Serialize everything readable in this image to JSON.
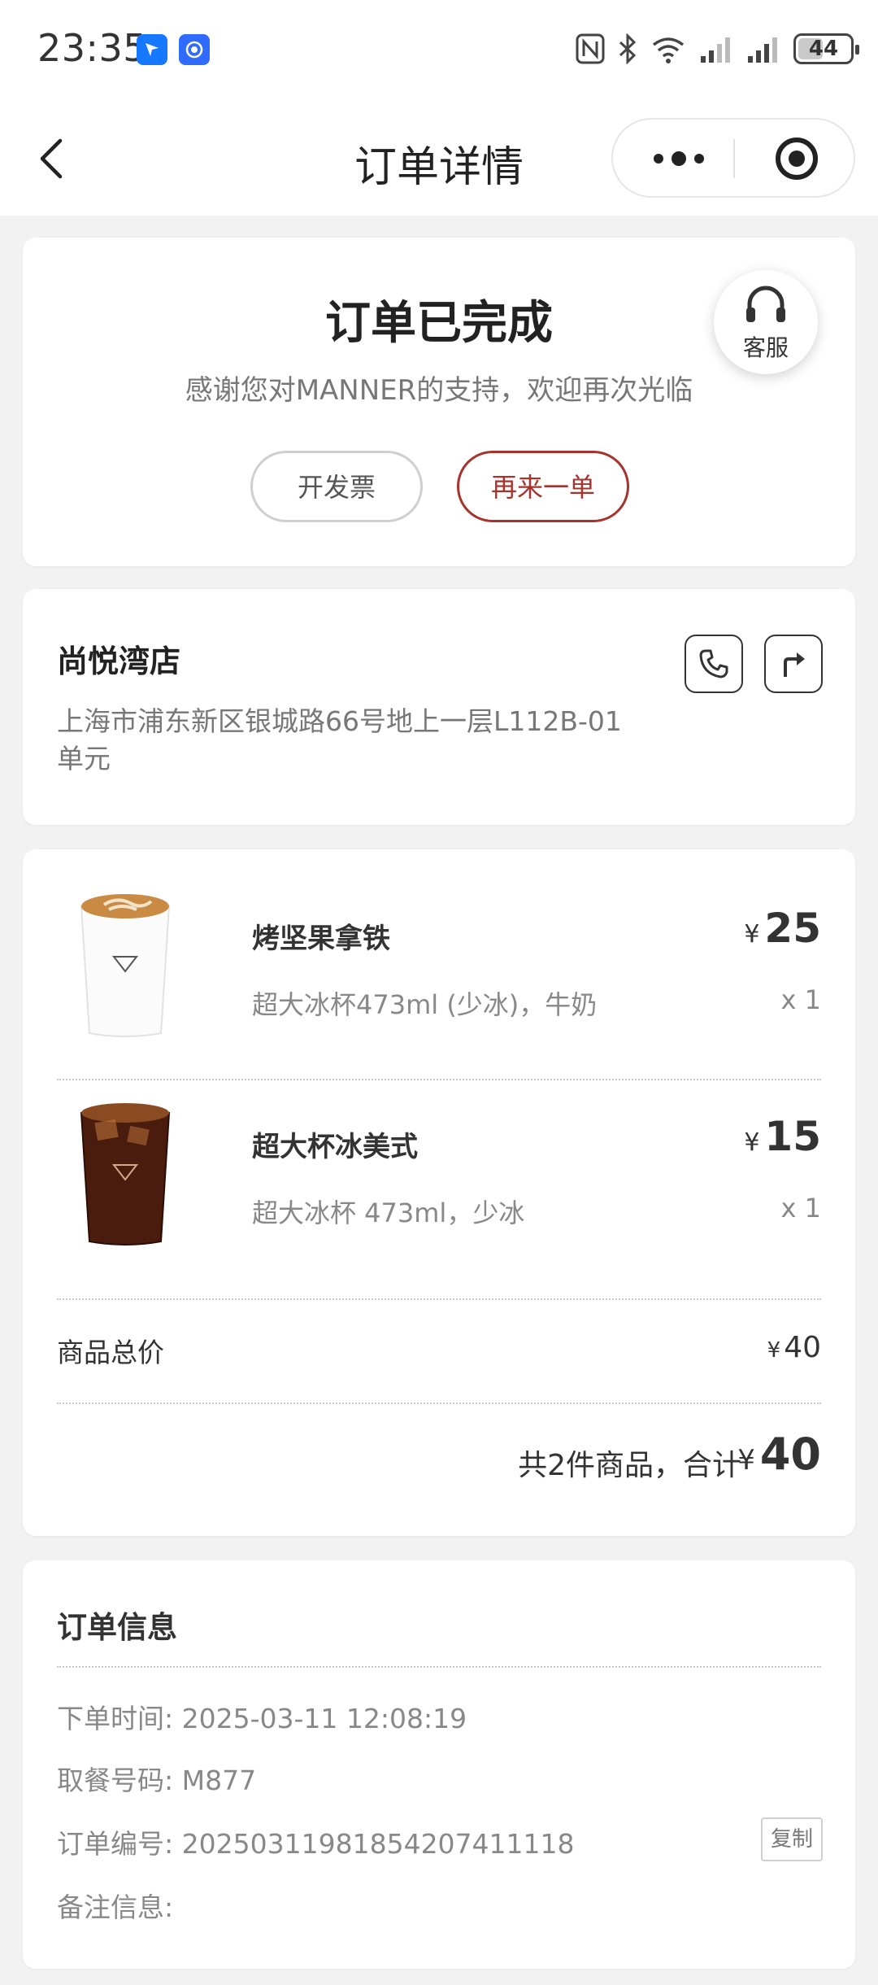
{
  "status_bar": {
    "time": "23:35",
    "battery": "44",
    "icons": [
      "nfc-icon",
      "bluetooth-icon",
      "wifi-icon",
      "signal-icon",
      "signal-icon",
      "battery-icon"
    ]
  },
  "navbar": {
    "title": "订单详情",
    "icons": [
      "back-icon",
      "more-icon",
      "target-icon"
    ]
  },
  "status_card": {
    "title": "订单已完成",
    "subtitle": "感谢您对MANNER的支持，欢迎再次光临",
    "invoice_label": "开发票",
    "reorder_label": "再来一单",
    "service_label": "客服",
    "accent_color": "#a8322c"
  },
  "store": {
    "name": "尚悦湾店",
    "address": "上海市浦东新区银城路66号地上一层L112B-01单元",
    "icons": [
      "phone-icon",
      "navigate-icon"
    ]
  },
  "order_items": [
    {
      "name": "烤坚果拿铁",
      "spec": "超大冰杯473ml (少冰)，牛奶",
      "currency": "¥",
      "price": "25",
      "qty": "x 1"
    },
    {
      "name": "超大杯冰美式",
      "spec": "超大冰杯 473ml，少冰",
      "currency": "¥",
      "price": "15",
      "qty": "x 1"
    }
  ],
  "totals": {
    "label": "商品总价",
    "currency": "¥",
    "value": "40",
    "summary_label": "共2件商品，合计",
    "summary_value": "40"
  },
  "order_info": {
    "title": "订单信息",
    "order_time_label": "下单时间:",
    "order_time": "2025-03-11 12:08:19",
    "pickup_label": "取餐号码:",
    "pickup_code": "M877",
    "order_no_label": "订单编号:",
    "order_no": "20250311981854207411118",
    "copy_label": "复制",
    "remark_label": "备注信息:"
  }
}
